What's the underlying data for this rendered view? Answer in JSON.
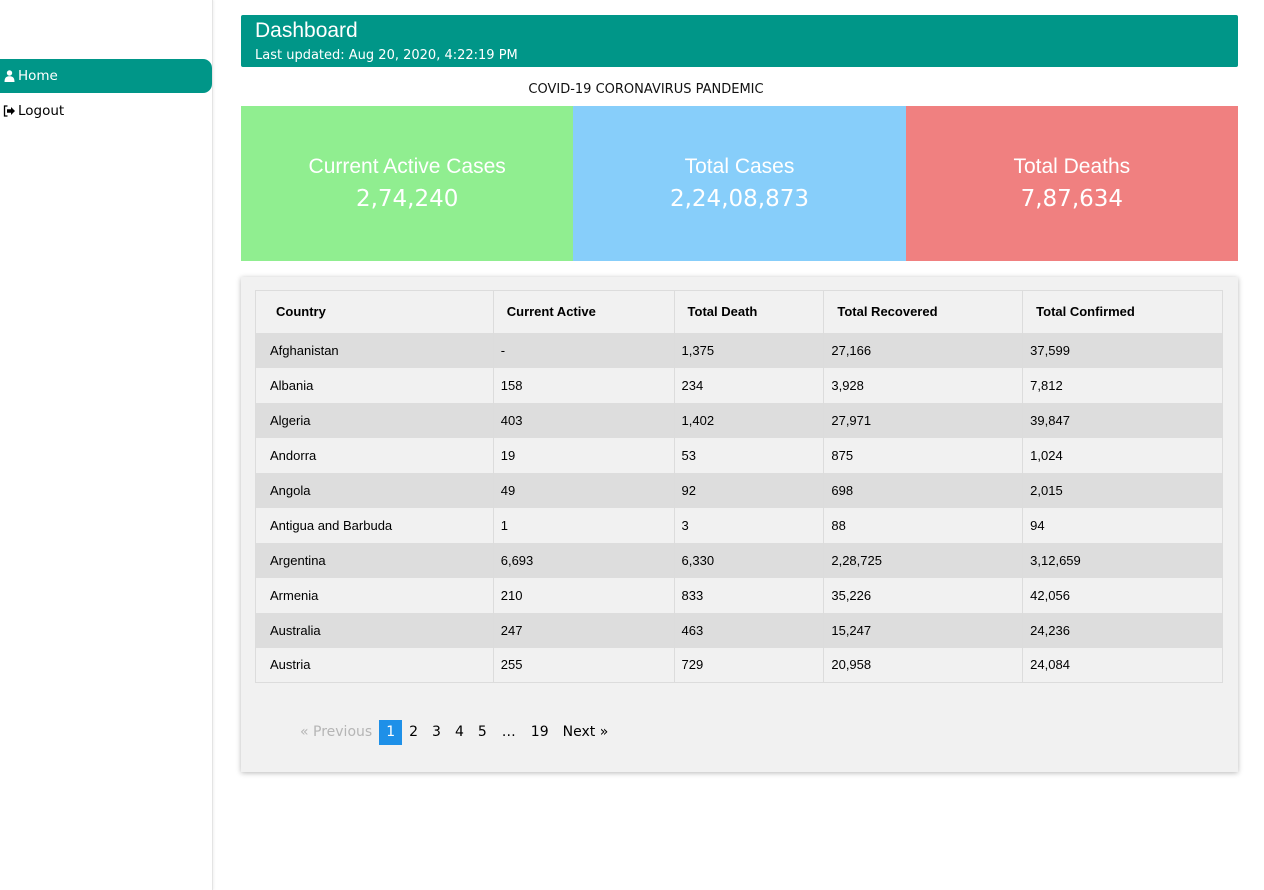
{
  "sidebar": {
    "items": [
      {
        "label": "Home",
        "icon": "user-icon",
        "active": true
      },
      {
        "label": "Logout",
        "icon": "logout-icon",
        "active": false
      }
    ]
  },
  "header": {
    "title": "Dashboard",
    "last_updated": "Last updated: Aug 20, 2020, 4:22:19 PM"
  },
  "subtitle": "COVID-19 CORONAVIRUS PANDEMIC",
  "cards": [
    {
      "label": "Current Active Cases",
      "value": "2,74,240",
      "color": "#90ee90"
    },
    {
      "label": "Total Cases",
      "value": "2,24,08,873",
      "color": "#87cefa"
    },
    {
      "label": "Total Deaths",
      "value": "7,87,634",
      "color": "#f08080"
    }
  ],
  "table": {
    "columns": [
      "Country",
      "Current Active",
      "Total Death",
      "Total Recovered",
      "Total Confirmed"
    ],
    "rows": [
      [
        "Afghanistan",
        "-",
        "1,375",
        "27,166",
        "37,599"
      ],
      [
        "Albania",
        "158",
        "234",
        "3,928",
        "7,812"
      ],
      [
        "Algeria",
        "403",
        "1,402",
        "27,971",
        "39,847"
      ],
      [
        "Andorra",
        "19",
        "53",
        "875",
        "1,024"
      ],
      [
        "Angola",
        "49",
        "92",
        "698",
        "2,015"
      ],
      [
        "Antigua and Barbuda",
        "1",
        "3",
        "88",
        "94"
      ],
      [
        "Argentina",
        "6,693",
        "6,330",
        "2,28,725",
        "3,12,659"
      ],
      [
        "Armenia",
        "210",
        "833",
        "35,226",
        "42,056"
      ],
      [
        "Australia",
        "247",
        "463",
        "15,247",
        "24,236"
      ],
      [
        "Austria",
        "255",
        "729",
        "20,958",
        "24,084"
      ]
    ]
  },
  "pagination": {
    "previous": "«  Previous",
    "pages": [
      "1",
      "2",
      "3",
      "4",
      "5"
    ],
    "ellipsis": "…",
    "last": "19",
    "next": "Next  »",
    "current": "1"
  },
  "colors": {
    "accent": "#009688",
    "current_page": "#1e90e8"
  }
}
